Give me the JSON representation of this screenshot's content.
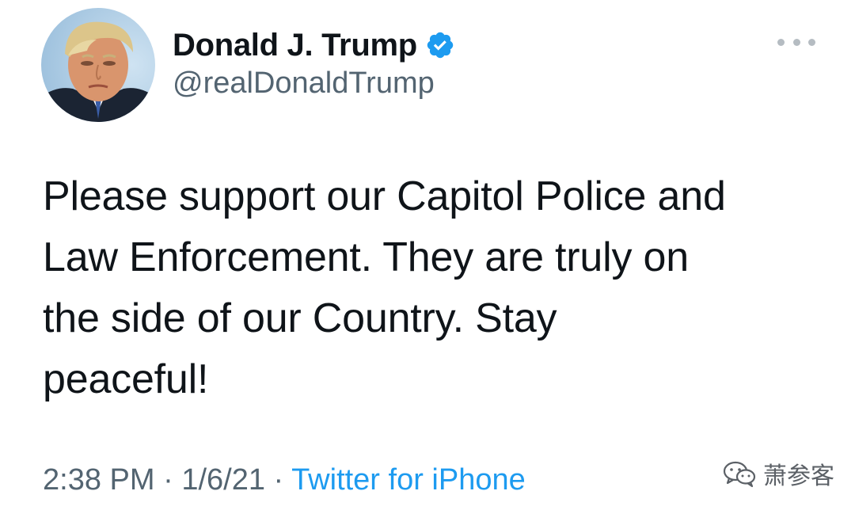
{
  "author": {
    "display_name": "Donald J. Trump",
    "handle": "@realDonaldTrump",
    "verified": true,
    "avatar_icon": "profile-photo",
    "verified_icon": "verified-badge-icon",
    "verified_color": "#1d9bf0"
  },
  "tweet": {
    "text": "Please support our Capitol Police and\nLaw Enforcement. They are truly on\nthe side of our Country. Stay\npeaceful!"
  },
  "meta": {
    "time": "2:38 PM",
    "separator": "·",
    "date": "1/6/21",
    "source": "Twitter for iPhone",
    "source_color": "#1d9bf0"
  },
  "more_icon": "more-dots-icon",
  "watermark": {
    "icon": "wechat-icon",
    "text": "萧参客"
  }
}
